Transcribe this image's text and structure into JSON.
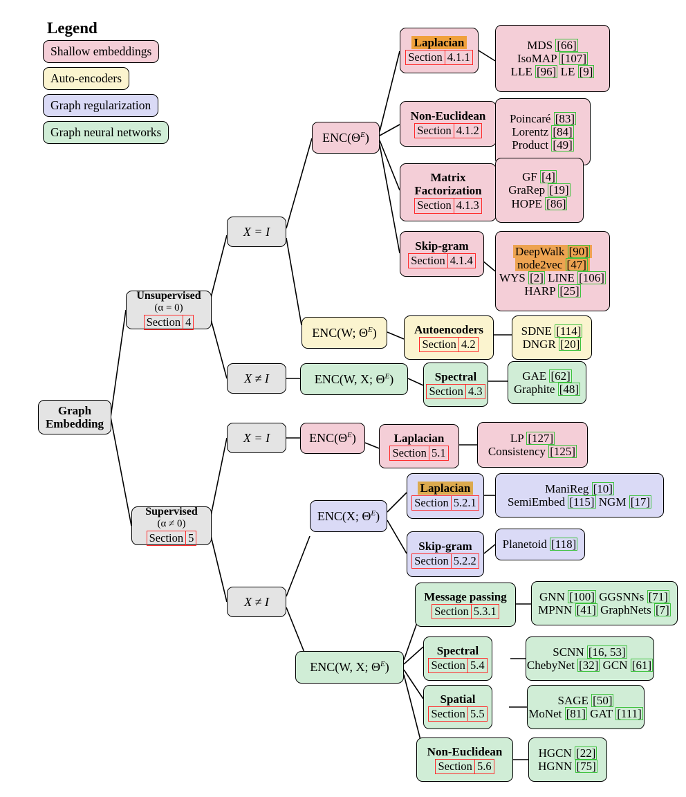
{
  "legend": {
    "title": "Legend",
    "items": [
      {
        "label": "Shallow embeddings",
        "color": "#f4ced7"
      },
      {
        "label": "Auto-encoders",
        "color": "#fbf4cf"
      },
      {
        "label": "Graph regularization",
        "color": "#dadaf6"
      },
      {
        "label": "Graph neural networks",
        "color": "#d0edd6"
      }
    ]
  },
  "root": {
    "line1": "Graph",
    "line2": "Embedding"
  },
  "branches": {
    "unsupervised": {
      "title": "Unsupervised",
      "condition": "(α = 0)",
      "section_label": "Section",
      "section_number": "4"
    },
    "supervised": {
      "title": "Supervised",
      "condition": "(α ≠ 0)",
      "section_label": "Section",
      "section_number": "5"
    }
  },
  "conditions": {
    "unsup_x_eq_i": "X = I",
    "unsup_x_neq_i": "X ≠ I",
    "sup_x_eq_i": "X = I",
    "sup_x_neq_i": "X ≠ I"
  },
  "encoders": {
    "enc_theta_unsup": "ENC(Θ",
    "enc_w_theta": "ENC(W; Θ",
    "enc_w_x_theta_unsup": "ENC(W, X; Θ",
    "enc_theta_sup": "ENC(Θ",
    "enc_x_theta": "ENC(X; Θ",
    "enc_w_x_theta_sup": "ENC(W, X; Θ",
    "superscript": "E",
    "close": ")"
  },
  "methods": [
    {
      "id": "laplacian-411",
      "title": "Laplacian",
      "title_highlight": "orange",
      "section_label": "Section",
      "section_number": "4.1.1",
      "color": "#f4ced7",
      "leaf_color": "#f4ced7",
      "leaf_lines": [
        [
          {
            "t": "MDS "
          },
          {
            "t": "[66]",
            "cite": true
          }
        ],
        [
          {
            "t": "IsoMAP "
          },
          {
            "t": "[107]",
            "cite": true
          }
        ],
        [
          {
            "t": "LLE "
          },
          {
            "t": "[96]",
            "cite": true
          },
          {
            "t": " LE "
          },
          {
            "t": "[9]",
            "cite": true
          }
        ]
      ]
    },
    {
      "id": "non-euclidean-412",
      "title": "Non-Euclidean",
      "title_highlight": "none",
      "section_label": "Section",
      "section_number": "4.1.2",
      "color": "#f4ced7",
      "leaf_color": "#f4ced7",
      "leaf_lines": [
        [
          {
            "t": "Poincaré "
          },
          {
            "t": "[83]",
            "cite": true
          }
        ],
        [
          {
            "t": "Lorentz "
          },
          {
            "t": "[84]",
            "cite": true
          }
        ],
        [
          {
            "t": "Product "
          },
          {
            "t": "[49]",
            "cite": true
          }
        ]
      ]
    },
    {
      "id": "matrix-factorization-413",
      "title": "Matrix\nFactorization",
      "title_highlight": "none",
      "section_label": "Section",
      "section_number": "4.1.3",
      "color": "#f4ced7",
      "leaf_color": "#f4ced7",
      "leaf_lines": [
        [
          {
            "t": "GF "
          },
          {
            "t": "[4]",
            "cite": true
          }
        ],
        [
          {
            "t": "GraRep "
          },
          {
            "t": "[19]",
            "cite": true
          }
        ],
        [
          {
            "t": "HOPE "
          },
          {
            "t": "[86]",
            "cite": true
          }
        ]
      ]
    },
    {
      "id": "skip-gram-414",
      "title": "Skip-gram",
      "title_highlight": "none",
      "section_label": "Section",
      "section_number": "4.1.4",
      "color": "#f4ced7",
      "leaf_color": "#f4ced7",
      "leaf_lines": [
        [
          {
            "t": "DeepWalk ",
            "hl": "orange"
          },
          {
            "t": "[90]",
            "cite": true,
            "hl": "orange"
          }
        ],
        [
          {
            "t": "node2vec ",
            "hl": "orange"
          },
          {
            "t": "[47]",
            "cite": true,
            "hl": "orange"
          }
        ],
        [
          {
            "t": "WYS "
          },
          {
            "t": "[2]",
            "cite": true
          },
          {
            "t": " LINE "
          },
          {
            "t": "[106]",
            "cite": true
          }
        ],
        [
          {
            "t": "HARP "
          },
          {
            "t": "[25]",
            "cite": true
          }
        ]
      ]
    },
    {
      "id": "autoencoders-42",
      "title": "Autoencoders",
      "title_highlight": "none",
      "section_label": "Section",
      "section_number": "4.2",
      "color": "#fbf4cf",
      "leaf_color": "#fbf4cf",
      "leaf_lines": [
        [
          {
            "t": "SDNE "
          },
          {
            "t": "[114]",
            "cite": true
          }
        ],
        [
          {
            "t": "DNGR "
          },
          {
            "t": "[20]",
            "cite": true
          }
        ]
      ]
    },
    {
      "id": "spectral-43",
      "title": "Spectral",
      "title_highlight": "none",
      "section_label": "Section",
      "section_number": "4.3",
      "color": "#d0edd6",
      "leaf_color": "#d0edd6",
      "leaf_lines": [
        [
          {
            "t": "GAE "
          },
          {
            "t": "[62]",
            "cite": true
          }
        ],
        [
          {
            "t": "Graphite "
          },
          {
            "t": "[48]",
            "cite": true
          }
        ]
      ]
    },
    {
      "id": "laplacian-51",
      "title": "Laplacian",
      "title_highlight": "none",
      "section_label": "Section",
      "section_number": "5.1",
      "color": "#f4ced7",
      "leaf_color": "#f4ced7",
      "leaf_lines": [
        [
          {
            "t": "LP "
          },
          {
            "t": "[127]",
            "cite": true
          }
        ],
        [
          {
            "t": "Consistency "
          },
          {
            "t": "[125]",
            "cite": true
          }
        ]
      ]
    },
    {
      "id": "laplacian-521",
      "title": "Laplacian",
      "title_highlight": "tan",
      "section_label": "Section",
      "section_number": "5.2.1",
      "color": "#dadaf6",
      "leaf_color": "#dadaf6",
      "leaf_lines": [
        [
          {
            "t": "ManiReg "
          },
          {
            "t": "[10]",
            "cite": true
          }
        ],
        [
          {
            "t": "SemiEmbed "
          },
          {
            "t": "[115]",
            "cite": true
          },
          {
            "t": " NGM "
          },
          {
            "t": "[17]",
            "cite": true
          }
        ]
      ]
    },
    {
      "id": "skip-gram-522",
      "title": "Skip-gram",
      "title_highlight": "none",
      "section_label": "Section",
      "section_number": "5.2.2",
      "color": "#dadaf6",
      "leaf_color": "#dadaf6",
      "leaf_lines": [
        [
          {
            "t": "Planetoid "
          },
          {
            "t": "[118]",
            "cite": true
          }
        ]
      ]
    },
    {
      "id": "message-passing-531",
      "title": "Message passing",
      "title_highlight": "none",
      "section_label": "Section",
      "section_number": "5.3.1",
      "color": "#d0edd6",
      "leaf_color": "#d0edd6",
      "leaf_lines": [
        [
          {
            "t": "GNN "
          },
          {
            "t": "[100]",
            "cite": true
          },
          {
            "t": " GGSNNs "
          },
          {
            "t": "[71]",
            "cite": true
          }
        ],
        [
          {
            "t": "MPNN "
          },
          {
            "t": "[41]",
            "cite": true
          },
          {
            "t": " GraphNets "
          },
          {
            "t": "[7]",
            "cite": true
          }
        ]
      ]
    },
    {
      "id": "spectral-54",
      "title": "Spectral",
      "title_highlight": "none",
      "section_label": "Section",
      "section_number": "5.4",
      "color": "#d0edd6",
      "leaf_color": "#d0edd6",
      "leaf_lines": [
        [
          {
            "t": "SCNN "
          },
          {
            "t": "[16, 53]",
            "cite": true
          }
        ],
        [
          {
            "t": "ChebyNet "
          },
          {
            "t": "[32]",
            "cite": true
          },
          {
            "t": " GCN "
          },
          {
            "t": "[61]",
            "cite": true
          }
        ]
      ]
    },
    {
      "id": "spatial-55",
      "title": "Spatial",
      "title_highlight": "none",
      "section_label": "Section",
      "section_number": "5.5",
      "color": "#d0edd6",
      "leaf_color": "#d0edd6",
      "leaf_lines": [
        [
          {
            "t": "SAGE "
          },
          {
            "t": "[50]",
            "cite": true
          }
        ],
        [
          {
            "t": "MoNet "
          },
          {
            "t": "[81]",
            "cite": true
          },
          {
            "t": " GAT "
          },
          {
            "t": "[111]",
            "cite": true
          }
        ]
      ]
    },
    {
      "id": "non-euclidean-56",
      "title": "Non-Euclidean",
      "title_highlight": "none",
      "section_label": "Section",
      "section_number": "5.6",
      "color": "#d0edd6",
      "leaf_color": "#d0edd6",
      "leaf_lines": [
        [
          {
            "t": "HGCN "
          },
          {
            "t": "[22]",
            "cite": true
          }
        ],
        [
          {
            "t": "HGNN "
          },
          {
            "t": "[75]",
            "cite": true
          }
        ]
      ]
    }
  ],
  "colors": {
    "shallow": "#f4ced7",
    "autoencoder": "#fbf4cf",
    "graph_regularization": "#dadaf6",
    "graph_neural_networks": "#d0edd6",
    "neutral": "#e4e4e4",
    "section_link_border": "#ff2b2b",
    "citation_link_border": "#3ec23e",
    "highlight_orange": "#f0a13c",
    "highlight_tan": "#dcaa4e"
  }
}
